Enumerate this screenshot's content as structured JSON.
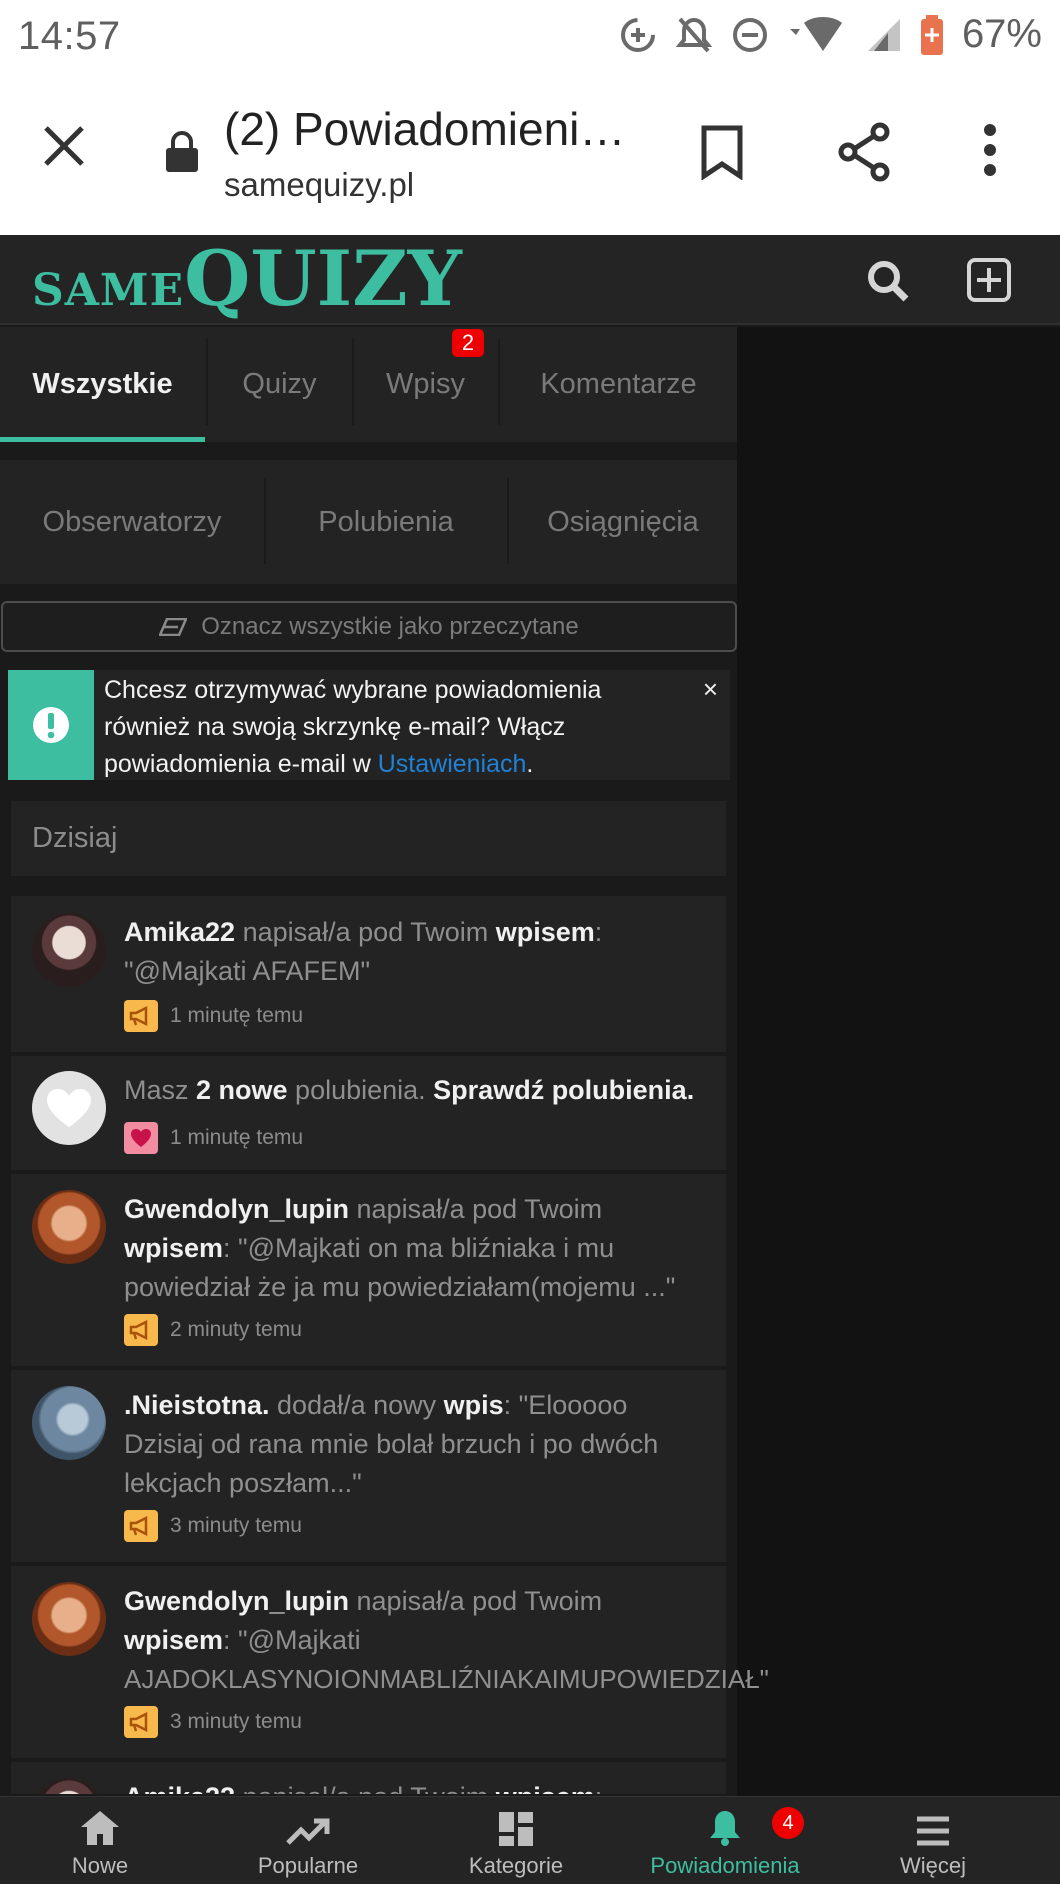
{
  "status_bar": {
    "time": "14:57",
    "battery": "67%"
  },
  "browser": {
    "page_title": "(2) Powiadomieni…",
    "domain": "samequizy.pl"
  },
  "site": {
    "logo_small": "SAME",
    "logo_big": "QUIZY",
    "accent_color": "#3dbea1"
  },
  "tabs_row1": [
    {
      "label": "Wszystkie",
      "active": true
    },
    {
      "label": "Quizy"
    },
    {
      "label": "Wpisy",
      "badge": "2"
    },
    {
      "label": "Komentarze"
    }
  ],
  "tabs_row2": [
    {
      "label": "Obserwatorzy"
    },
    {
      "label": "Polubienia"
    },
    {
      "label": "Osiągnięcia"
    }
  ],
  "mark_all_label": "Oznacz wszystkie jako przeczytane",
  "alert": {
    "text": "Chcesz otrzymywać wybrane powiadomienia również na swoją skrzynkę e-mail? Włącz powiadomienia e-mail w ",
    "link": "Ustawieniach",
    "end": ".",
    "close": "×"
  },
  "section_label": "Dzisiaj",
  "notifications": [
    {
      "user": "Amika22",
      "action": " napisał/a pod Twoim ",
      "target": "wpisem",
      "line1_end": ":",
      "line2": "\"@Majkati AFAFEM\"",
      "time": "1 minutę temu"
    },
    {
      "prefix": "Masz ",
      "count": "2 nowe",
      "middle": " polubienia. ",
      "link": "Sprawdź polubienia.",
      "time": "1 minutę temu"
    },
    {
      "user": "Gwendolyn_lupin",
      "action": " napisał/a pod Twoim",
      "target": "wpisem",
      "line2_rest": ": \"@Majkati on ma bliźniaka i mu",
      "line3": "powiedział że ja mu powiedziałam(mojemu ...\"",
      "time": "2 minuty temu"
    },
    {
      "user": ".Nieistotna.",
      "action": " dodał/a nowy ",
      "target": "wpis",
      "line1_rest": ": \"Elooooo",
      "line2": "Dzisiaj od rana mnie bolał brzuch i po dwóch",
      "line3": "lekcjach poszłam...\"",
      "time": "3 minuty temu"
    },
    {
      "user": "Gwendolyn_lupin",
      "action": " napisał/a pod Twoim",
      "target": "wpisem",
      "line2_rest": ": \"@Majkati",
      "line3": "AJADOKLASYNOIONMABLIŹNIAKAIMUPOWIEDZIAŁ\"",
      "time": "3 minuty temu"
    },
    {
      "user": "Amika22",
      "action": " napisał/a pod Twoim ",
      "target": "wpisem",
      "line1_end": ":"
    }
  ],
  "bottom_nav": [
    {
      "label": "Nowe",
      "icon": "home-icon"
    },
    {
      "label": "Popularne",
      "icon": "trending-icon"
    },
    {
      "label": "Kategorie",
      "icon": "dashboard-icon"
    },
    {
      "label": "Powiadomienia",
      "icon": "bell-icon",
      "active": true,
      "badge": "4"
    },
    {
      "label": "Więcej",
      "icon": "menu-icon"
    }
  ]
}
